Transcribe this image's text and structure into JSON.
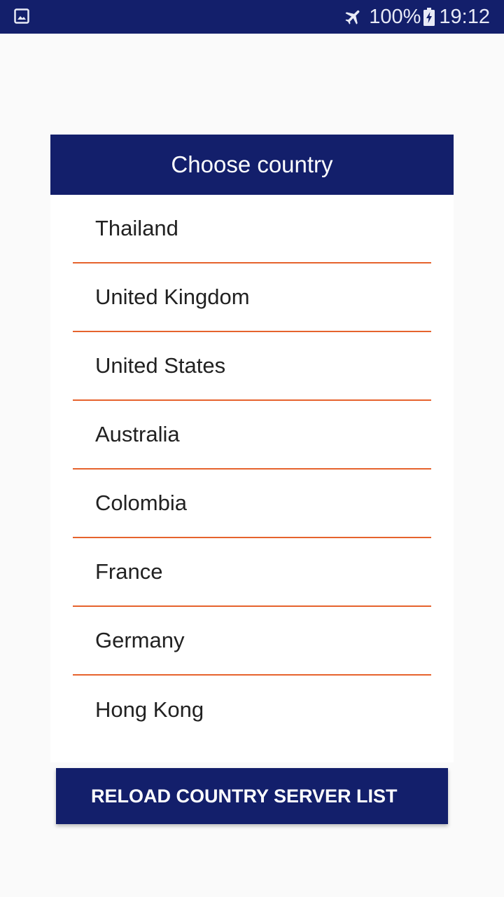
{
  "status_bar": {
    "battery": "100%",
    "time": "19:12",
    "icons": [
      "image-icon",
      "airplane-mode-icon",
      "battery-charging-icon"
    ]
  },
  "dialog": {
    "title": "Choose country",
    "countries": [
      "Thailand",
      "United Kingdom",
      "United States",
      "Australia",
      "Colombia",
      "France",
      "Germany",
      "Hong Kong"
    ]
  },
  "reload_button": {
    "label": "RELOAD COUNTRY SERVER LIST"
  },
  "colors": {
    "primary": "#131f6b",
    "divider": "#e6632d",
    "background": "#fafafa"
  }
}
